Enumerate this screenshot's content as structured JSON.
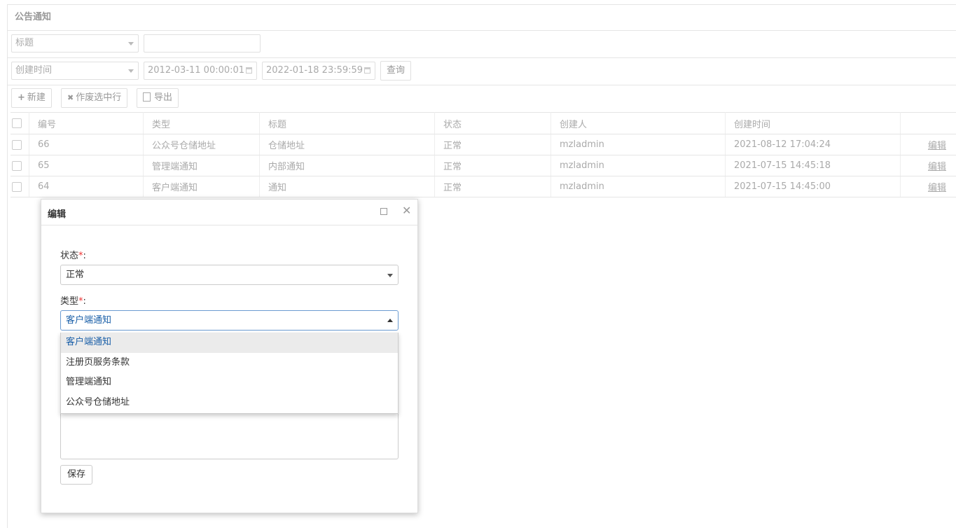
{
  "panel": {
    "title": "公告通知"
  },
  "filters": {
    "field_select": "标题",
    "keyword_value": "",
    "date_field_select": "创建时间",
    "date_start": "2012-03-11 00:00:01",
    "date_end": "2022-01-18 23:59:59",
    "query_label": "查询"
  },
  "toolbar": {
    "new_label": "新建",
    "void_label": "作废选中行",
    "export_label": "导出"
  },
  "table": {
    "headers": [
      "编号",
      "类型",
      "标题",
      "状态",
      "创建人",
      "创建时间"
    ],
    "rows": [
      {
        "id": "66",
        "type": "公众号仓储地址",
        "title": "仓储地址",
        "status": "正常",
        "creator": "mzladmin",
        "created": "2021-08-12 17:04:24",
        "action": "编辑"
      },
      {
        "id": "65",
        "type": "管理端通知",
        "title": "内部通知",
        "status": "正常",
        "creator": "mzladmin",
        "created": "2021-07-15 14:45:18",
        "action": "编辑"
      },
      {
        "id": "64",
        "type": "客户端通知",
        "title": "通知",
        "status": "正常",
        "creator": "mzladmin",
        "created": "2021-07-15 14:45:00",
        "action": "编辑"
      }
    ]
  },
  "dialog": {
    "title": "编辑",
    "status_label": "状态",
    "status_value": "正常",
    "type_label": "类型",
    "required_mark": "*",
    "colon": ":",
    "type_value": "客户端通知",
    "type_options": [
      "客户端通知",
      "注册页服务条款",
      "管理端通知",
      "公众号仓储地址"
    ],
    "save_label": "保存"
  }
}
